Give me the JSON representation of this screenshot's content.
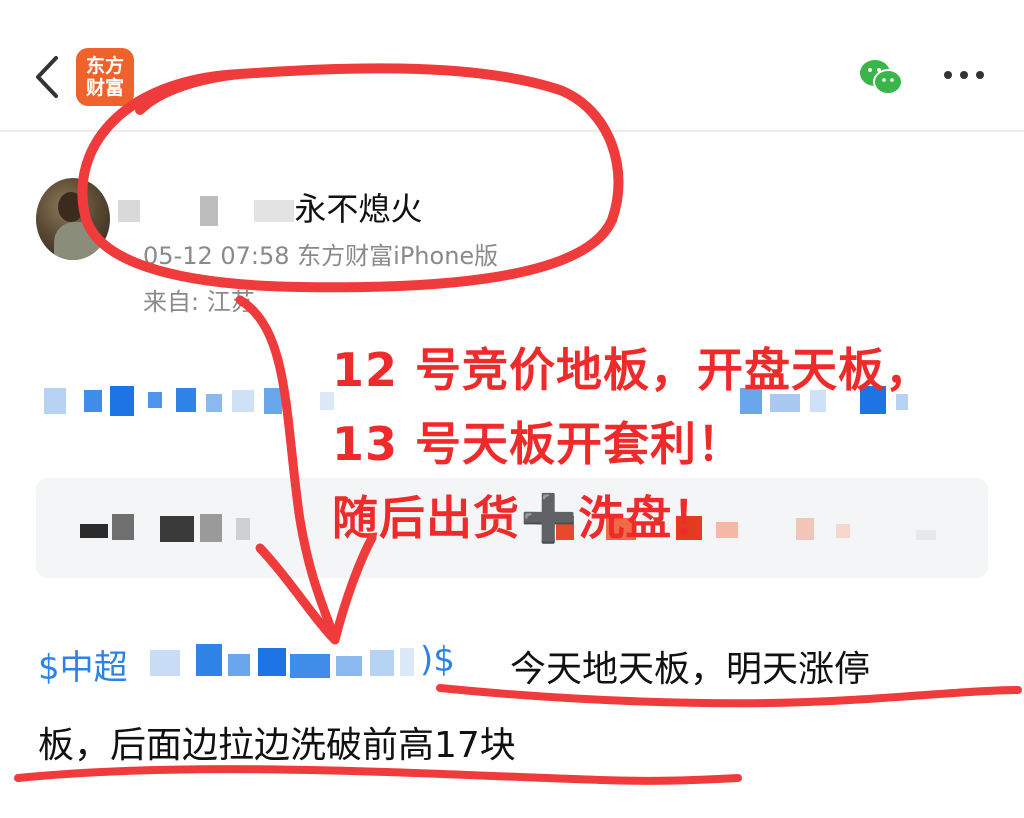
{
  "header": {
    "back_icon": "chevron-left-icon",
    "logo_line1": "东方",
    "logo_line2": "财富",
    "wechat_icon": "wechat-icon",
    "more_icon": "more-dots-icon"
  },
  "author": {
    "name_visible": "永不熄火",
    "time_source": "05-12 07:58 东方财富iPhone版",
    "location": "来自: 江苏"
  },
  "annotation": {
    "line1": "12 号竞价地板，开盘天板，",
    "line2": "13 号天板开套利！",
    "line3": "随后出货➕洗盘！"
  },
  "post": {
    "stock_prefix": "$中超",
    "stock_suffix": ")$",
    "text_line1": "今天地天板，明天涨停",
    "text_line2": "板，后面边拉边洗破前高17块"
  },
  "colors": {
    "brand_orange": "#f0622b",
    "annotation_red": "#ef2a2a",
    "link_blue": "#2c82e6"
  }
}
